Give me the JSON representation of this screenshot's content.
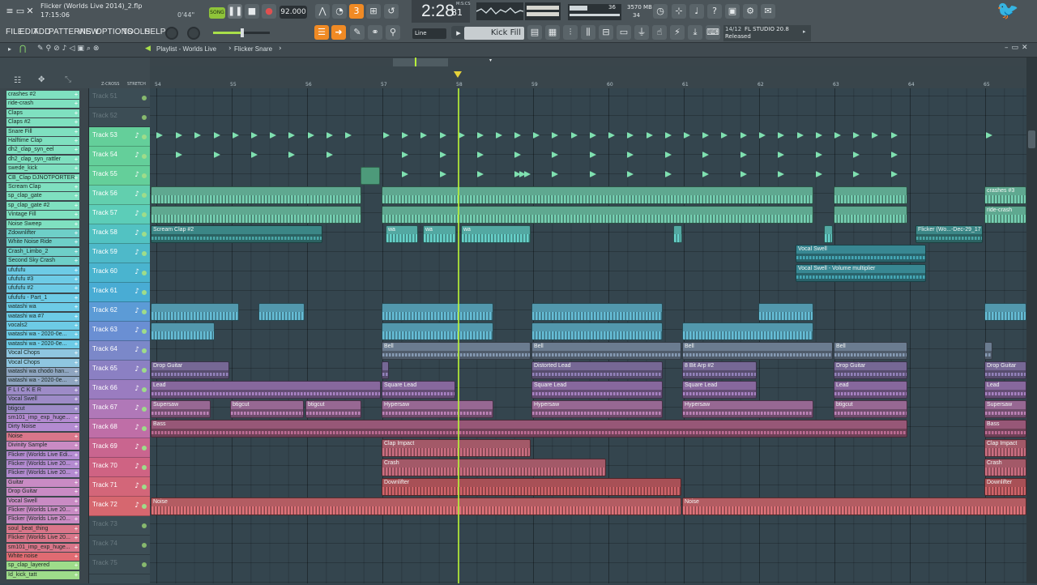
{
  "app": {
    "title": "Flicker (Worlds Live 2014)_2.flp",
    "clock": "17:15:06",
    "song_pos": "0'44\"",
    "tempo": "92.000",
    "time": "2:28",
    "time_sub": "81",
    "time_unit": "M:S:CS",
    "cpu": "36",
    "mem": "3570 MB",
    "mem2": "34",
    "version": "FL STUDIO 20.8",
    "version_date": "14/12",
    "version_status": "Released",
    "song_mode": "SONG",
    "pattern_mode": "PAT"
  },
  "menu": {
    "items": [
      "FILE",
      "EDIT",
      "ADD",
      "PATTERNS",
      "VIEW",
      "OPTIONS",
      "TOOLS",
      "HELP"
    ],
    "snap": "Line",
    "pattern": "Kick Fill"
  },
  "playlist": {
    "breadcrumb": "Playlist - Worlds Live",
    "arrow": "›",
    "clip": "Flicker Snare",
    "zcross": "Z-CROSS",
    "stretch": "STRETCH"
  },
  "ruler": {
    "bars": [
      "54",
      "55",
      "56",
      "57",
      "58",
      "59",
      "60",
      "61",
      "62",
      "63",
      "64",
      "65"
    ]
  },
  "picker": [
    "crashes #2",
    "ride-crash",
    "Claps",
    "Claps #2",
    "Snare Fill",
    "Halftime Clap",
    "dh2_clap_syn_eel",
    "dh2_clap_syn_rattler",
    "swede_kick",
    "CB_Clap DJNOTPORTER",
    "Scream Clap",
    "sp_clap_gate",
    "sp_clap_gate #2",
    "Vintage Fill",
    "Noise Sweep",
    "Zdownlifter",
    "White Noise Ride",
    "Crash_Limbo_2",
    "Second Sky Crash",
    "ufufufu",
    "ufufufu #3",
    "ufufufu #2",
    "ufufufu - Part_1",
    "watashi wa",
    "watashi wa #7",
    "vocals2",
    "watashi wa - 2020-0e...",
    "watashi wa - 2020-0e...",
    "Vocal Chops",
    "Vocal Chops",
    "watashi wa chodo han...",
    "watashi wa - 2020-0e...",
    "F L I C K E R",
    "Vocal Swell",
    "btigcut",
    "sm101_imp_exp_huge...",
    "Dirty Noise",
    "Noise",
    "Divinity Sample",
    "Flicker (Worlds Live Edi...",
    "Flicker (Worlds Live 20...",
    "Flicker (Worlds Live 20...",
    "Guitar",
    "Drop Guitar",
    "Vocal Swell",
    "Flicker (Worlds Live 20...",
    "Flicker (Worlds Live 20...",
    "soul_beat_thing",
    "Flicker (Worlds Live 20...",
    "sm101_imp_exp_huge...",
    "White noise",
    "sp_clap_layered",
    "Id_kick_tatt"
  ],
  "tracks": [
    "Track 51",
    "Track 52",
    "Track 53",
    "Track 54",
    "Track 55",
    "Track 56",
    "Track 57",
    "Track 58",
    "Track 59",
    "Track 60",
    "Track 61",
    "Track 62",
    "Track 63",
    "Track 64",
    "Track 65",
    "Track 66",
    "Track 67",
    "Track 68",
    "Track 69",
    "Track 70",
    "Track 71",
    "Track 72",
    "Track 73",
    "Track 74",
    "Track 75"
  ],
  "clips": [
    {
      "track": 5,
      "start": 0,
      "end": 261,
      "name": "",
      "c": "#7fe0c0"
    },
    {
      "track": 5,
      "start": 285,
      "end": 819,
      "name": "",
      "c": "#7fe0c0"
    },
    {
      "track": 5,
      "start": 843,
      "end": 935,
      "name": "",
      "c": "#7fe0c0"
    },
    {
      "track": 5,
      "start": 1029,
      "end": 1082,
      "name": "crashes #3",
      "c": "#7fe0c0"
    },
    {
      "track": 6,
      "start": 0,
      "end": 261,
      "name": "",
      "c": "#7fe0c0"
    },
    {
      "track": 6,
      "start": 285,
      "end": 819,
      "name": "",
      "c": "#7fe0c0"
    },
    {
      "track": 6,
      "start": 843,
      "end": 935,
      "name": "",
      "c": "#7fe0c0"
    },
    {
      "track": 6,
      "start": 1029,
      "end": 1082,
      "name": "ride-crash",
      "c": "#7fe0c0"
    },
    {
      "track": 7,
      "start": 0,
      "end": 213,
      "name": "Scream Clap #2",
      "c": "#4fb3b3"
    },
    {
      "track": 7,
      "start": 290,
      "end": 331,
      "name": "wa",
      "c": "#6ee0d8"
    },
    {
      "track": 7,
      "start": 336,
      "end": 378,
      "name": "wa",
      "c": "#6ee0d8"
    },
    {
      "track": 7,
      "start": 383,
      "end": 470,
      "name": "wa",
      "c": "#6ee0d8"
    },
    {
      "track": 7,
      "start": 645,
      "end": 657,
      "name": "",
      "c": "#6ee0d8"
    },
    {
      "track": 7,
      "start": 831,
      "end": 843,
      "name": "",
      "c": "#6ee0d8"
    },
    {
      "track": 7,
      "start": 944,
      "end": 1028,
      "name": "Flicker (Wo...-Dec-29_17",
      "c": "#4fb3b3"
    },
    {
      "track": 8,
      "start": 796,
      "end": 958,
      "name": "Vocal Swell",
      "c": "#4ab4c3"
    },
    {
      "track": 9,
      "start": 796,
      "end": 958,
      "name": "Vocal Swell - Volume multiplier",
      "c": "#4ab4c3"
    },
    {
      "track": 11,
      "start": 0,
      "end": 110,
      "name": "",
      "c": "#6dcbe6"
    },
    {
      "track": 11,
      "start": 133,
      "end": 191,
      "name": "",
      "c": "#6dcbe6"
    },
    {
      "track": 11,
      "start": 285,
      "end": 424,
      "name": "",
      "c": "#6dcbe6"
    },
    {
      "track": 11,
      "start": 470,
      "end": 633,
      "name": "",
      "c": "#6dcbe6"
    },
    {
      "track": 11,
      "start": 750,
      "end": 819,
      "name": "",
      "c": "#6dcbe6"
    },
    {
      "track": 11,
      "start": 1029,
      "end": 1082,
      "name": "",
      "c": "#6dcbe6"
    },
    {
      "track": 12,
      "start": 0,
      "end": 80,
      "name": "",
      "c": "#6dcbe6"
    },
    {
      "track": 12,
      "start": 285,
      "end": 424,
      "name": "",
      "c": "#6dcbe6"
    },
    {
      "track": 12,
      "start": 470,
      "end": 633,
      "name": "",
      "c": "#6dcbe6"
    },
    {
      "track": 12,
      "start": 656,
      "end": 819,
      "name": "",
      "c": "#6dcbe6"
    },
    {
      "track": 13,
      "start": 285,
      "end": 470,
      "name": "Bell",
      "c": "#8fa5c0"
    },
    {
      "track": 13,
      "start": 470,
      "end": 656,
      "name": "Bell",
      "c": "#8fa5c0"
    },
    {
      "track": 13,
      "start": 656,
      "end": 843,
      "name": "Bell",
      "c": "#8fa5c0"
    },
    {
      "track": 13,
      "start": 843,
      "end": 935,
      "name": "Bell",
      "c": "#8fa5c0"
    },
    {
      "track": 13,
      "start": 1029,
      "end": 1040,
      "name": "",
      "c": "#8fa5c0"
    },
    {
      "track": 14,
      "start": 0,
      "end": 98,
      "name": "Drop Guitar",
      "c": "#9d8bc7"
    },
    {
      "track": 14,
      "start": 285,
      "end": 295,
      "name": "",
      "c": "#9d8bc7"
    },
    {
      "track": 14,
      "start": 470,
      "end": 633,
      "name": "Distorted Lead",
      "c": "#9d8bc7"
    },
    {
      "track": 14,
      "start": 656,
      "end": 749,
      "name": "8 Bit Arp #2",
      "c": "#9d8bc7"
    },
    {
      "track": 14,
      "start": 843,
      "end": 935,
      "name": "Drop Guitar",
      "c": "#9d8bc7"
    },
    {
      "track": 14,
      "start": 1029,
      "end": 1082,
      "name": "Drop Guitar",
      "c": "#9d8bc7"
    },
    {
      "track": 15,
      "start": 0,
      "end": 285,
      "name": "Lead",
      "c": "#b48bd1"
    },
    {
      "track": 15,
      "start": 285,
      "end": 377,
      "name": "Square Lead",
      "c": "#b48bd1"
    },
    {
      "track": 15,
      "start": 470,
      "end": 633,
      "name": "Square Lead",
      "c": "#b48bd1"
    },
    {
      "track": 15,
      "start": 656,
      "end": 749,
      "name": "Square Lead",
      "c": "#b48bd1"
    },
    {
      "track": 15,
      "start": 843,
      "end": 935,
      "name": "Lead",
      "c": "#b48bd1"
    },
    {
      "track": 15,
      "start": 1029,
      "end": 1082,
      "name": "Lead",
      "c": "#b48bd1"
    },
    {
      "track": 16,
      "start": 0,
      "end": 75,
      "name": "Supersaw",
      "c": "#c98bc4"
    },
    {
      "track": 16,
      "start": 98,
      "end": 190,
      "name": "btigcut",
      "c": "#c98bc4"
    },
    {
      "track": 16,
      "start": 191,
      "end": 261,
      "name": "btigcut",
      "c": "#c98bc4"
    },
    {
      "track": 16,
      "start": 285,
      "end": 424,
      "name": "Hypersaw",
      "c": "#c98bc4"
    },
    {
      "track": 16,
      "start": 470,
      "end": 633,
      "name": "Hypersaw",
      "c": "#c98bc4"
    },
    {
      "track": 16,
      "start": 656,
      "end": 819,
      "name": "Hypersaw",
      "c": "#c98bc4"
    },
    {
      "track": 16,
      "start": 843,
      "end": 935,
      "name": "btigcut",
      "c": "#c98bc4"
    },
    {
      "track": 16,
      "start": 1029,
      "end": 1082,
      "name": "Supersaw",
      "c": "#c98bc4"
    },
    {
      "track": 17,
      "start": 0,
      "end": 935,
      "name": "Bass",
      "c": "#c9749e"
    },
    {
      "track": 17,
      "start": 1029,
      "end": 1082,
      "name": "Bass",
      "c": "#c9749e"
    },
    {
      "track": 18,
      "start": 285,
      "end": 470,
      "name": "Clap Impact",
      "c": "#d9768a"
    },
    {
      "track": 18,
      "start": 1029,
      "end": 1082,
      "name": "Clap Impact",
      "c": "#d9768a"
    },
    {
      "track": 19,
      "start": 285,
      "end": 563,
      "name": "Crash",
      "c": "#d9768a"
    },
    {
      "track": 19,
      "start": 1029,
      "end": 1082,
      "name": "Crash",
      "c": "#d9768a"
    },
    {
      "track": 20,
      "start": 285,
      "end": 656,
      "name": "Downlifter",
      "c": "#e06b72"
    },
    {
      "track": 20,
      "start": 1029,
      "end": 1082,
      "name": "Downlifter",
      "c": "#e06b72"
    },
    {
      "track": 21,
      "start": 0,
      "end": 656,
      "name": "Noise",
      "c": "#ef7b83"
    },
    {
      "track": 21,
      "start": 656,
      "end": 1082,
      "name": "Noise",
      "c": "#ef7b83"
    }
  ],
  "markers": [
    {
      "track": 2,
      "x": [
        8,
        32,
        55,
        79,
        102,
        125,
        148,
        171,
        195,
        218,
        241,
        288,
        311,
        334,
        358,
        381,
        404,
        427,
        450,
        473,
        496,
        520,
        543,
        566,
        589,
        613,
        636,
        659,
        682,
        705,
        729,
        752,
        775,
        799,
        822,
        845,
        868,
        891,
        915,
        1032
      ]
    },
    {
      "track": 3,
      "x": [
        32,
        79,
        125,
        171,
        218,
        311,
        358,
        404,
        450,
        496,
        543,
        589,
        636,
        682,
        729,
        775,
        822,
        868,
        915
      ]
    },
    {
      "track": 4,
      "x": [
        311,
        358,
        404,
        450,
        456,
        462,
        496,
        543,
        589,
        636,
        682,
        729,
        775,
        822,
        868,
        915
      ]
    }
  ],
  "playhead": 380,
  "colors": {
    "accent": "#f08a24",
    "playhead": "#b6f03a"
  }
}
